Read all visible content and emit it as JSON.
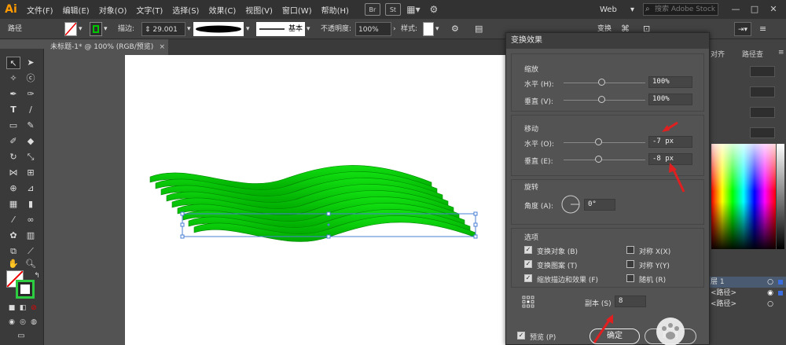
{
  "app": {
    "logo": "Ai"
  },
  "menu": {
    "items": [
      "文件(F)",
      "编辑(E)",
      "对象(O)",
      "文字(T)",
      "选择(S)",
      "效果(C)",
      "视图(V)",
      "窗口(W)",
      "帮助(H)"
    ],
    "bridge": "Br",
    "stock": "St",
    "workspace": "Web",
    "search_placeholder": "搜索 Adobe Stock"
  },
  "control_bar": {
    "object_type": "路径",
    "stroke_label": "描边:",
    "stroke_value": "29.001",
    "profile_label": "基本",
    "opacity_label": "不透明度:",
    "opacity_value": "100%",
    "style_label": "样式:",
    "transform_label": "变换"
  },
  "document_tab": {
    "title": "未标题-1* @ 100% (RGB/预览)",
    "close": "×"
  },
  "right_panel": {
    "tabs": [
      "对齐",
      "路径查"
    ],
    "layer_name": "层 1",
    "sublayers": [
      "<路径>",
      "<路径>"
    ]
  },
  "dialog": {
    "title": "变换效果",
    "scale": {
      "heading": "缩放",
      "h_label": "水平 (H):",
      "h_value": "100%",
      "v_label": "垂直 (V):",
      "v_value": "100%"
    },
    "move": {
      "heading": "移动",
      "h_label": "水平 (O):",
      "h_value": "-7 px",
      "v_label": "垂直 (E):",
      "v_value": "-8 px"
    },
    "rotate": {
      "heading": "旋转",
      "angle_label": "角度 (A):",
      "angle_value": "0°"
    },
    "options": {
      "heading": "选项",
      "transform_objects": "变换对象 (B)",
      "transform_patterns": "变换图案 (T)",
      "scale_strokes": "缩放描边和效果 (F)",
      "reflect_x": "对称 X(X)",
      "reflect_y": "对称 Y(Y)",
      "random": "随机 (R)",
      "checked": {
        "transform_objects": true,
        "transform_patterns": true,
        "scale_strokes": true,
        "reflect_x": false,
        "reflect_y": false,
        "random": false
      }
    },
    "copies_label": "副本 (S)",
    "copies_value": "8",
    "preview_label": "预览 (P)",
    "preview_checked": true,
    "ok_label": "确定",
    "cancel_label": "取消"
  },
  "colors": {
    "wave_green": "#00cc00",
    "wave_dark": "#008800",
    "selection_blue": "#4a7fd6",
    "annotation_red": "#e02020",
    "accent_orange": "#ff9a00"
  }
}
